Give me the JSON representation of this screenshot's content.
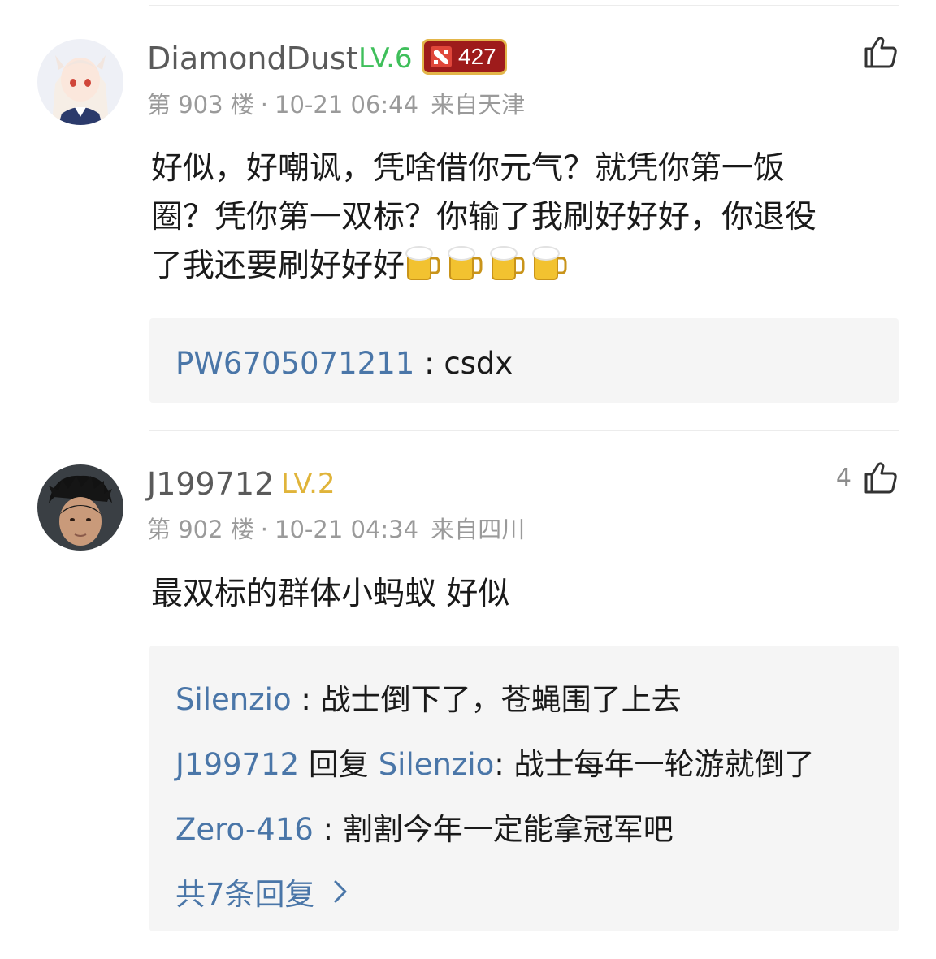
{
  "colors": {
    "username": "#5a5a5a",
    "level6": "#3fbf5b",
    "level2": "#e0b43a",
    "link": "#4a76a8",
    "meta": "#9a9a9a",
    "reply_bg": "#f5f5f5",
    "badge_bg": "#9e1b1b"
  },
  "comments": [
    {
      "username": "DiamondDust",
      "level": "LV.6",
      "badge": {
        "icon": "dota-logo-icon",
        "count": "427"
      },
      "floor": "第 903 楼",
      "time": "10-21 06:44",
      "location": "来自天津",
      "like_count": "",
      "content_lines": [
        "好似，好嘲讽，凭啥借你元气？就凭你第一饭",
        "圈？凭你第一双标？你输了我刷好好好，你退役",
        "了我还要刷好好好"
      ],
      "emojis": [
        "🍺",
        "🍺",
        "🍺",
        "🍺"
      ],
      "replies": [
        {
          "user": "PW6705071211",
          "separator": " : ",
          "text": "csdx"
        }
      ]
    },
    {
      "username": "J199712",
      "level": "LV.2",
      "floor": "第 902 楼",
      "time": "10-21 04:34",
      "location": "来自四川",
      "like_count": "4",
      "content_lines": [
        "最双标的群体小蚂蚁 好似"
      ],
      "replies": [
        {
          "user": "Silenzio",
          "separator": " : ",
          "text": "战士倒下了，苍蝇围了上去"
        },
        {
          "user": "J199712",
          "reply_word": " 回复 ",
          "reply_to": "Silenzio",
          "separator": ": ",
          "text": "战士每年一轮游就倒了"
        },
        {
          "user": "Zero-416",
          "separator": " : ",
          "text": "割割今年一定能拿冠军吧"
        }
      ],
      "more_replies": "共7条回复"
    }
  ]
}
